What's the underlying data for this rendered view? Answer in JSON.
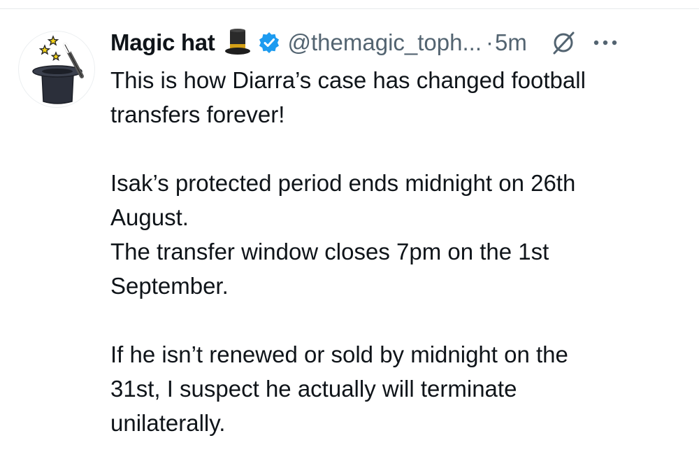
{
  "tweet": {
    "author": {
      "display_name": "Magic hat",
      "name_emoji": "top-hat-emoji",
      "verified": true,
      "verified_color": "#1d9bf0",
      "handle": "@themagic_toph...",
      "avatar": "magic-hat-with-wand-avatar"
    },
    "separator": "·",
    "time": "5m",
    "actions": {
      "grok_icon": "grok-slash-circle-icon",
      "more_icon": "more-horizontal-icon"
    },
    "text": {
      "line1": "This is how Diarra’s case has changed football",
      "line2": "transfers forever!",
      "line3": "Isak’s protected period ends midnight on 26th",
      "line4": "August.",
      "line5": "The transfer window closes 7pm on the 1st",
      "line6": "September.",
      "line7": "If he isn’t renewed or sold by midnight on the",
      "line8": "31st, I suspect he actually will terminate",
      "line9": "unilaterally."
    }
  },
  "colors": {
    "text_primary": "#0f1419",
    "text_secondary": "#536471",
    "divider": "#e6e9ec",
    "background": "#ffffff"
  }
}
